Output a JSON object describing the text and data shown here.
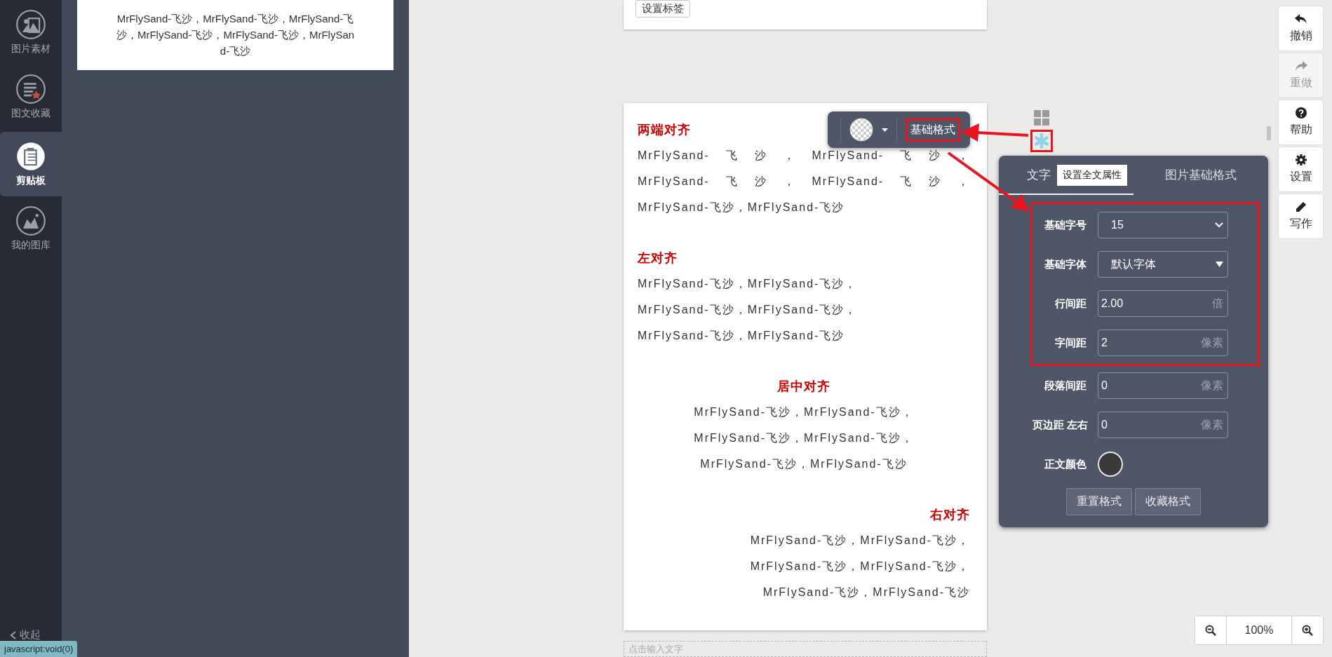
{
  "sidebar": {
    "items": [
      {
        "label": "图片素材",
        "selected": false
      },
      {
        "label": "图文收藏",
        "selected": false
      },
      {
        "label": "剪贴板",
        "selected": true
      },
      {
        "label": "我的图库",
        "selected": false
      }
    ],
    "collapse": "收起"
  },
  "clipboard": {
    "lines": [
      "MrFlySand-飞沙，MrFlySand-飞沙，MrFlySand-飞",
      "沙，MrFlySand-飞沙，MrFlySand-飞沙，MrFlySan",
      "d-飞沙"
    ]
  },
  "editor": {
    "top_button": "设置标签",
    "floating_toolbar": {
      "format_button": "基础格式",
      "highlighted": true
    },
    "sections": [
      {
        "heading": "两端对齐",
        "kind": "justify",
        "lines": [
          "MrFlySand-飞沙，MrFlySand-飞沙，",
          "MrFlySand-飞沙，MrFlySand-飞沙，",
          "MrFlySand-飞沙，MrFlySand-飞沙"
        ]
      },
      {
        "heading": "左对齐",
        "kind": "left",
        "lines": [
          "MrFlySand-飞沙，MrFlySand-飞沙，",
          "MrFlySand-飞沙，MrFlySand-飞沙，",
          "MrFlySand-飞沙，MrFlySand-飞沙"
        ]
      },
      {
        "heading": "居中对齐",
        "kind": "center",
        "lines": [
          "MrFlySand-飞沙，MrFlySand-飞沙，",
          "MrFlySand-飞沙，MrFlySand-飞沙，",
          "MrFlySand-飞沙，MrFlySand-飞沙"
        ]
      },
      {
        "heading": "右对齐",
        "kind": "right",
        "lines": [
          "MrFlySand-飞沙，MrFlySand-飞沙，",
          "MrFlySand-飞沙，MrFlySand-飞沙，",
          "MrFlySand-飞沙，MrFlySand-飞沙"
        ]
      }
    ],
    "input_placeholder": "点击输入文字"
  },
  "side_icons": {
    "settings_highlighted": true,
    "tooltip": "设置全文属性"
  },
  "settings_panel": {
    "tabs": [
      {
        "label": "文字",
        "selected": true
      },
      {
        "label": "图片基础格式",
        "selected": false
      }
    ],
    "rows": [
      {
        "kind": "select",
        "label": "基础字号",
        "value": "15",
        "highlighted": true
      },
      {
        "kind": "dropdown",
        "label": "基础字体",
        "value": "默认字体",
        "highlighted": true
      },
      {
        "kind": "input",
        "label": "行间距",
        "value": "2.00",
        "unit": "倍",
        "highlighted": true
      },
      {
        "kind": "input",
        "label": "字间距",
        "value": "2",
        "unit": "像素",
        "highlighted": true
      },
      {
        "kind": "input",
        "label": "段落间距",
        "value": "0",
        "unit": "像素",
        "highlighted": false
      },
      {
        "kind": "input",
        "label": "页边距 左右",
        "value": "0",
        "unit": "像素",
        "highlighted": false
      },
      {
        "kind": "color",
        "label": "正文颜色",
        "color": "#3a3a3a",
        "highlighted": false
      }
    ],
    "buttons": [
      "重置格式",
      "收藏格式"
    ]
  },
  "toolbar": [
    {
      "label": "撤销",
      "disabled": false
    },
    {
      "label": "重做",
      "disabled": true
    },
    {
      "label": "帮助",
      "disabled": false
    },
    {
      "label": "设置",
      "disabled": false
    },
    {
      "label": "写作",
      "disabled": false
    }
  ],
  "zoom": {
    "value": "100%"
  },
  "status_bar": "javascript:void(0)"
}
